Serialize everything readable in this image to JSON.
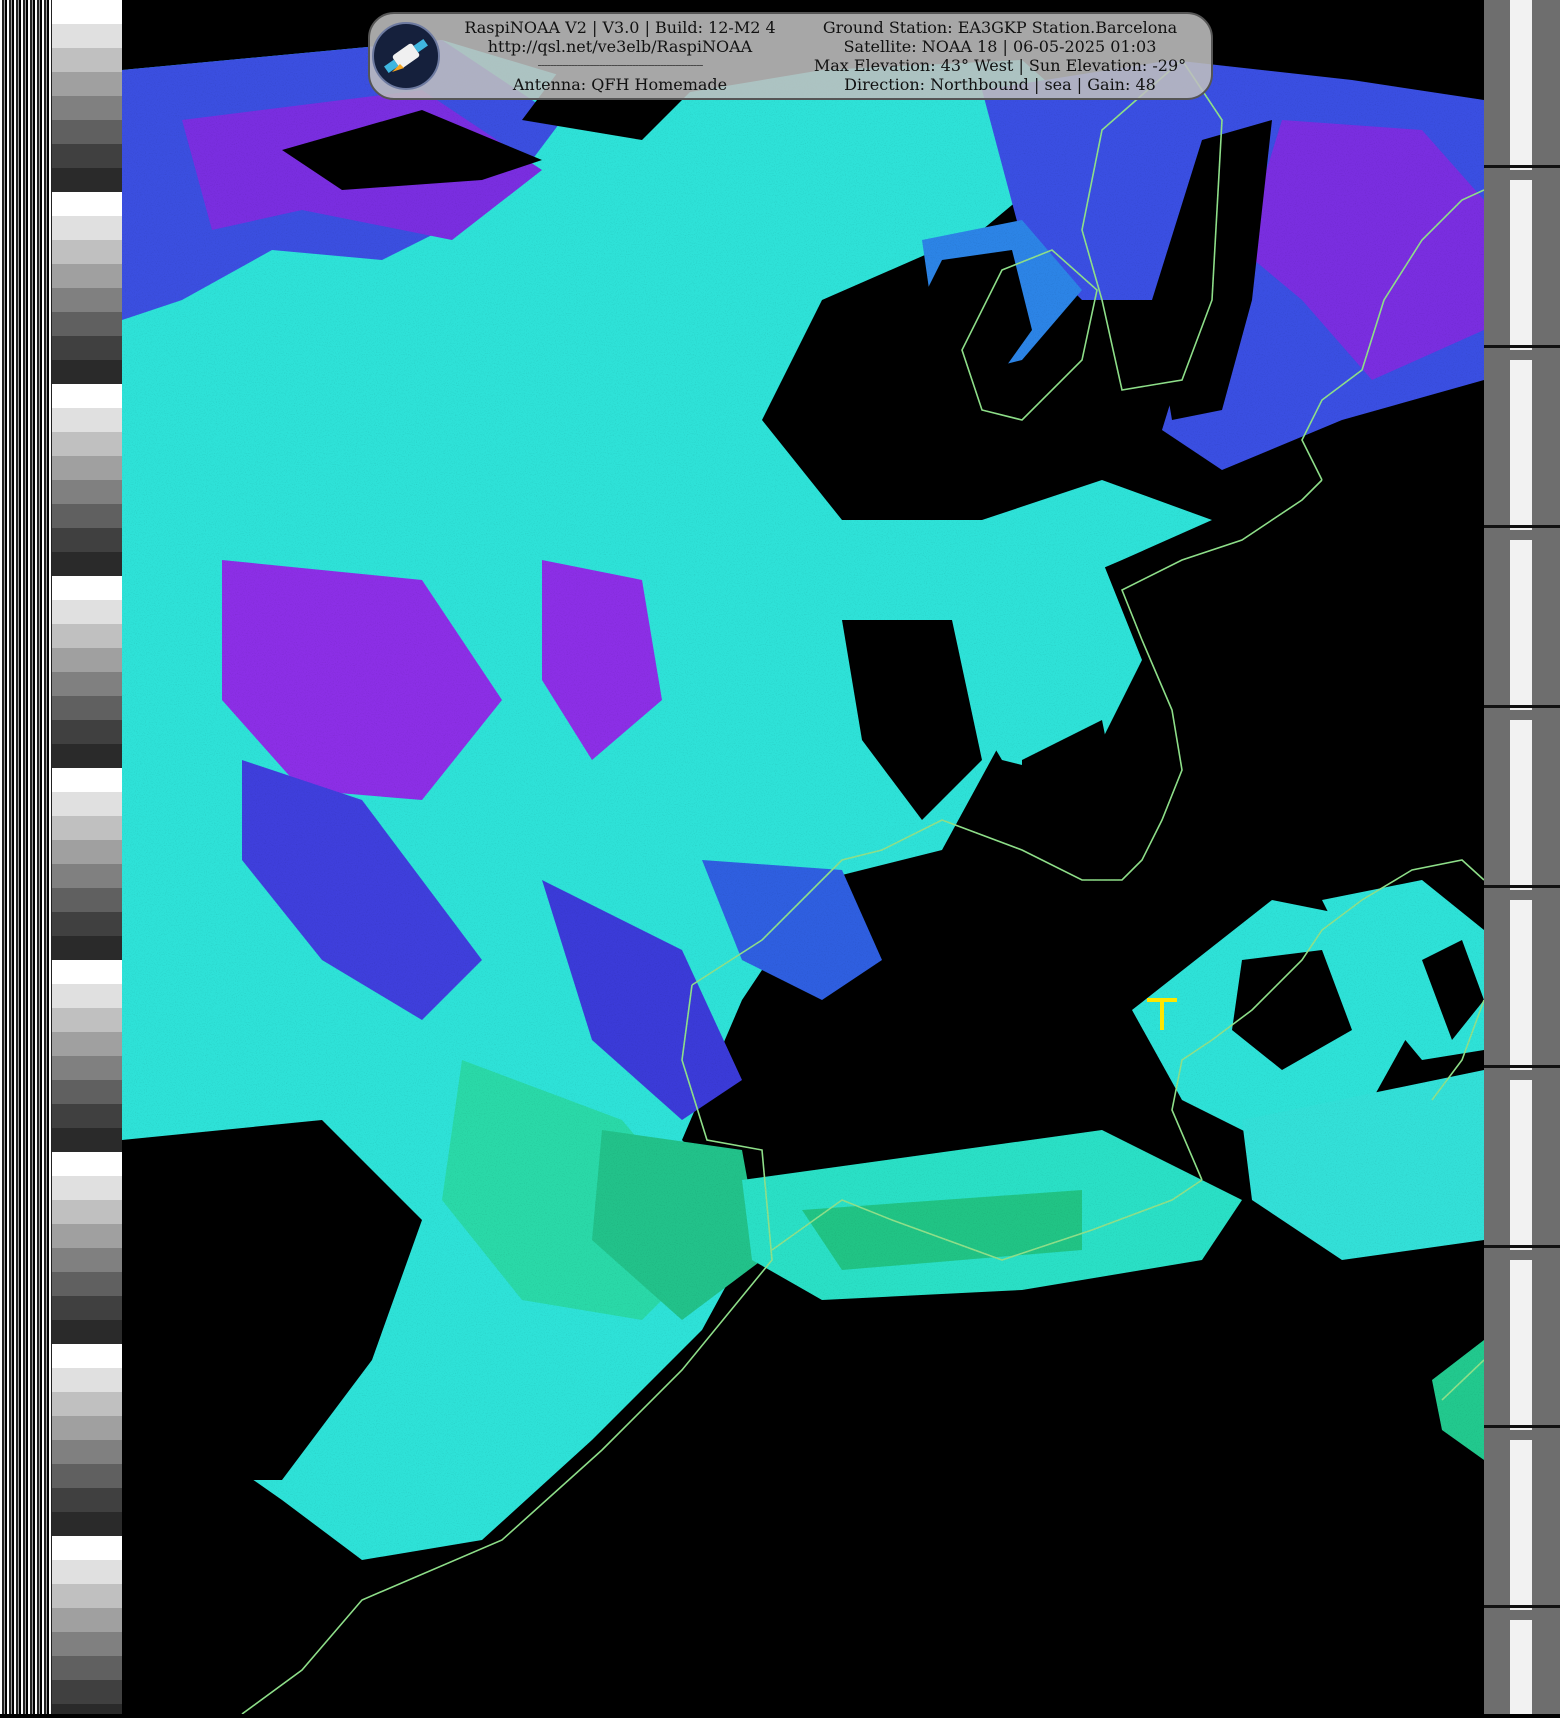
{
  "header": {
    "left_lines": [
      "RaspiNOAA V2 | V3.0 | Build: 12-M2 4",
      "http://qsl.net/ve3elb/RaspiNOAA",
      "------------------------------------------------------",
      "Antenna: QFH Homemade"
    ],
    "right_lines": [
      "Ground Station: EA3GKP Station.Barcelona",
      "Satellite: NOAA 18 | 06-05-2025 01:03",
      "Max Elevation: 43° West | Sun Elevation: -29°",
      "Direction: Northbound | sea | Gain: 48"
    ]
  },
  "logo": {
    "icon": "satellite-icon"
  },
  "map": {
    "palette": {
      "ocean": "#000000",
      "coast": "#8fe08a",
      "cloud_low": "#3cf0e0",
      "cloud_mid": "#3f5fe8",
      "cloud_high": "#8a2be2",
      "warm": "#22cc88",
      "marker": "#ffe600"
    },
    "station_marker": "crosshair-icon"
  }
}
